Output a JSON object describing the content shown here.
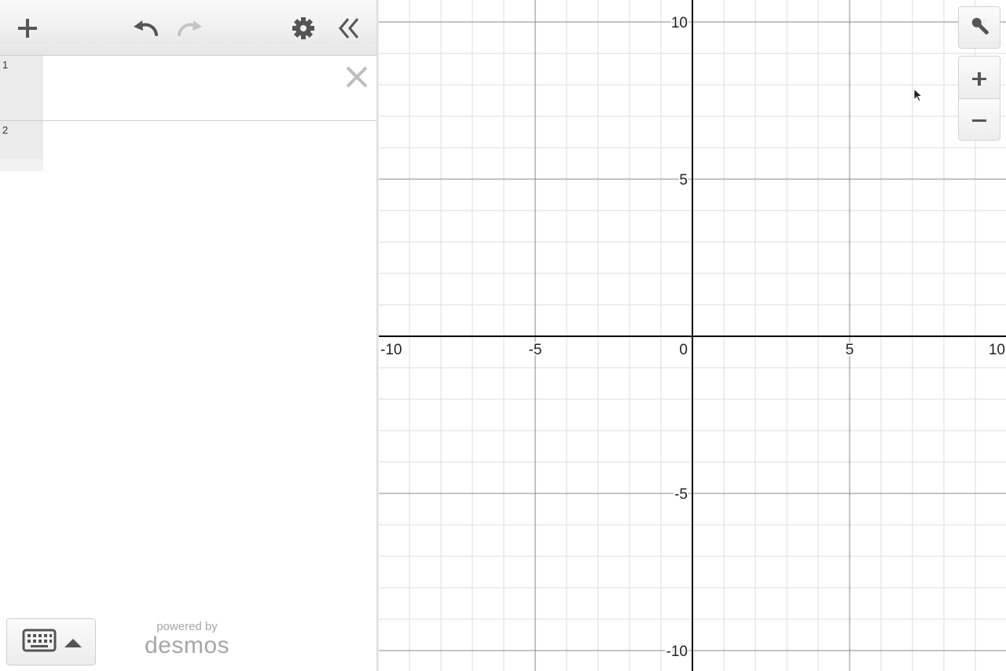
{
  "app": {
    "name": "desmos"
  },
  "toolbar": {
    "add_icon": "plus-icon",
    "undo_icon": "undo-icon",
    "redo_icon": "redo-icon",
    "settings_icon": "gear-icon",
    "collapse_icon": "double-chevron-left-icon"
  },
  "expressions": [
    {
      "index": "1",
      "latex": ""
    },
    {
      "index": "2",
      "latex": ""
    }
  ],
  "footer": {
    "keyboard_icon": "keyboard-icon",
    "powered_by": "powered by",
    "brand": "desmos"
  },
  "graph": {
    "x_range": [
      -10,
      10
    ],
    "y_range": [
      -10.7,
      10.7
    ],
    "major_step": 5,
    "minor_step": 1,
    "x_ticks": [
      "-10",
      "-5",
      "0",
      "5",
      "10"
    ],
    "y_ticks": [
      "10",
      "5",
      "-5",
      "-10"
    ],
    "controls": [
      "wrench-icon",
      "zoom-in-icon",
      "zoom-out-icon"
    ],
    "colors": {
      "axis": "#000000",
      "major_grid": "#888888",
      "minor_grid": "#dcdcdc"
    }
  }
}
